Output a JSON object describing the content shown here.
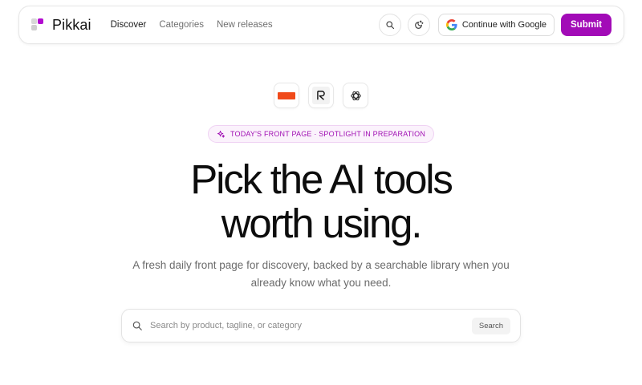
{
  "brand": {
    "name": "Pikkai",
    "accent": "#a20bb7"
  },
  "nav": {
    "links": [
      {
        "label": "Discover",
        "active": true
      },
      {
        "label": "Categories",
        "active": false
      },
      {
        "label": "New releases",
        "active": false
      }
    ],
    "search_icon": "search-icon",
    "theme_icon": "theme-toggle-icon",
    "google_label": "Continue with Google",
    "submit_label": "Submit"
  },
  "hero": {
    "partner_icons": [
      "orange-brand-logo",
      "r-brand-logo",
      "openai-logo"
    ],
    "badge": "TODAY'S FRONT PAGE · SPOTLIGHT IN PREPARATION",
    "headline_line1": "Pick the AI tools",
    "headline_line2": "worth using.",
    "subtitle": "A fresh daily front page for discovery, backed by a searchable library when you already know what you need."
  },
  "search": {
    "placeholder": "Search by product, tagline, or category",
    "value": "",
    "button_label": "Search"
  }
}
